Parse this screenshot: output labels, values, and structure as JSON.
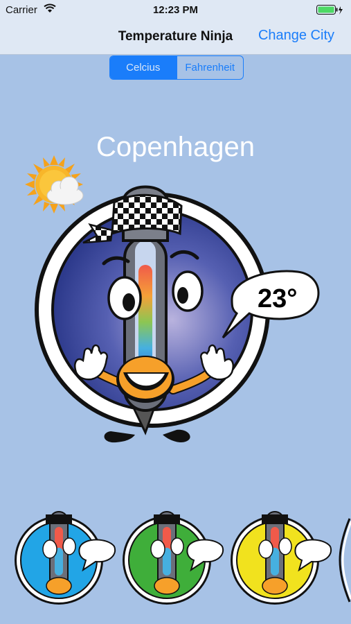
{
  "status_bar": {
    "carrier": "Carrier",
    "time": "12:23 PM"
  },
  "nav": {
    "title": "Temperature Ninja",
    "right_button": "Change City"
  },
  "units": {
    "options": [
      "Celcius",
      "Fahrenheit"
    ],
    "selected": "Celcius"
  },
  "city": "Copenhagen",
  "weather": {
    "icon": "sun-cloud-icon"
  },
  "temperature": "23°",
  "carousel": {
    "thumbnails": [
      {
        "theme": "blue",
        "color": "#22a5e6"
      },
      {
        "theme": "green",
        "color": "#3fae3a"
      },
      {
        "theme": "yellow",
        "color": "#f1e21e"
      }
    ]
  },
  "colors": {
    "accent": "#1a7dfa",
    "background": "#a7c2e6",
    "main_circle": "#3c4aa0",
    "battery": "#4cd964"
  }
}
